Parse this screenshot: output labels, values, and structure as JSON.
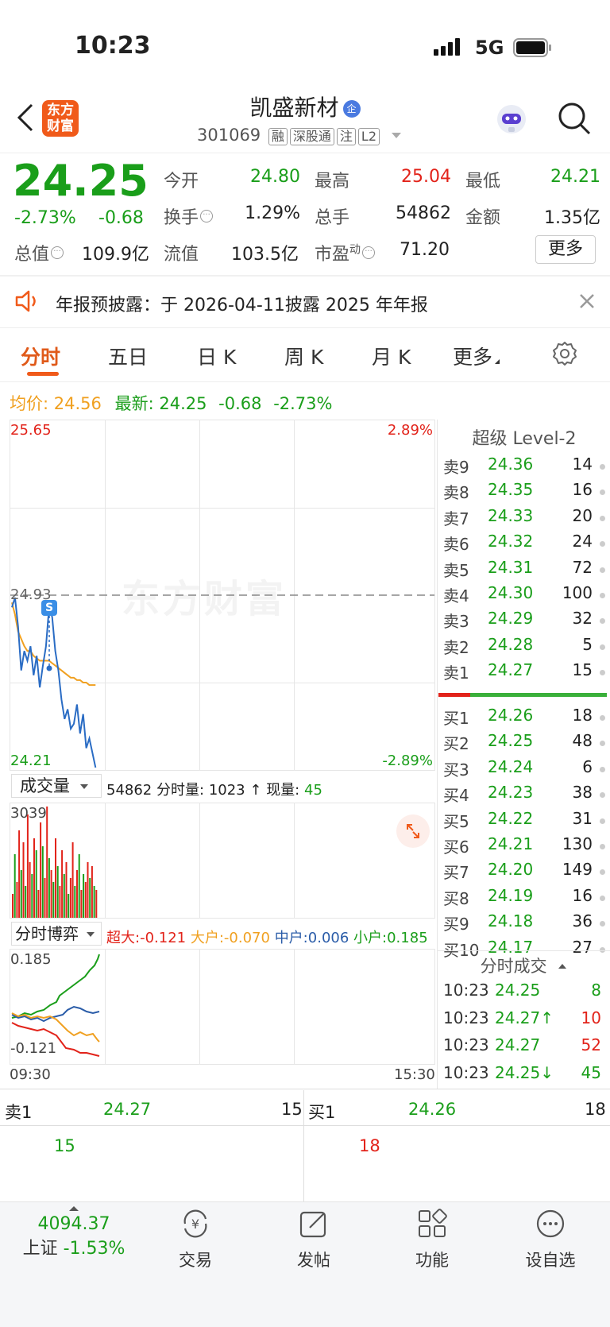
{
  "status_bar": {
    "time": "10:23",
    "network": "5G"
  },
  "header": {
    "name": "凯盛新材",
    "badge": "企",
    "code": "301069",
    "tags": [
      "融",
      "深股通",
      "注",
      "L2"
    ],
    "logo_line1": "东方",
    "logo_line2": "财富"
  },
  "quote": {
    "price": "24.25",
    "change_pct": "-2.73%",
    "change": "-0.68",
    "open_label": "今开",
    "open": "24.80",
    "high_label": "最高",
    "high": "25.04",
    "low_label": "最低",
    "low": "24.21",
    "turnover_label": "换手",
    "turnover": "1.29%",
    "volume_label": "总手",
    "volume": "54862",
    "amount_label": "金额",
    "amount": "1.35亿",
    "mktcap_label": "总值",
    "mktcap": "109.9亿",
    "float_label": "流值",
    "float": "103.5亿",
    "pe_label": "市盈",
    "pe_sup": "动",
    "pe": "71.20",
    "more": "更多"
  },
  "notice": {
    "text": "年报预披露：于 2026-04-11披露 2025 年年报"
  },
  "tabs": [
    "分时",
    "五日",
    "日 K",
    "周 K",
    "月 K",
    "更多"
  ],
  "summary": {
    "avg_label": "均价:",
    "avg": "24.56",
    "latest_label": "最新:",
    "latest": "24.25",
    "change": "-0.68",
    "pct": "-2.73%"
  },
  "chart": {
    "y_high": "25.65",
    "y_low": "24.21",
    "y_ref": "24.93",
    "pct_high": "2.89%",
    "pct_low": "-2.89%",
    "watermark": "东方财富",
    "marker": "S",
    "volume_selector": "成交量",
    "volume_info_total": "54862",
    "volume_info_label": "分时量:",
    "volume_info_val": "1023",
    "volume_info_now_label": "现量:",
    "volume_info_now": "45",
    "volume_max": "3039",
    "flow_selector": "分时博弈",
    "flow": [
      {
        "label": "超大:",
        "value": "-0.121",
        "color": "#e2231a"
      },
      {
        "label": "大户:",
        "value": "-0.070",
        "color": "#f0a020"
      },
      {
        "label": "中户:",
        "value": "0.006",
        "color": "#2a5ca8"
      },
      {
        "label": "小户:",
        "value": "0.185",
        "color": "#1a9e1a"
      }
    ],
    "flow_max": "0.185",
    "flow_min": "-0.121",
    "time_start": "09:30",
    "time_end": "15:30",
    "price_series": [
      24.88,
      24.92,
      24.8,
      24.62,
      24.7,
      24.66,
      24.72,
      24.6,
      24.68,
      24.55,
      24.64,
      24.72,
      24.88,
      24.84,
      24.7,
      24.62,
      24.5,
      24.42,
      24.46,
      24.38,
      24.4,
      24.48,
      24.36,
      24.44,
      24.3,
      24.34,
      24.28,
      24.22
    ],
    "avg_series": [
      24.9,
      24.85,
      24.78,
      24.75,
      24.72,
      24.7,
      24.7,
      24.68,
      24.67,
      24.66,
      24.66,
      24.66,
      24.66,
      24.65,
      24.64,
      24.63,
      24.62,
      24.61,
      24.6,
      24.59,
      24.59,
      24.58,
      24.58,
      24.57,
      24.57,
      24.56,
      24.56,
      24.56
    ]
  },
  "level2": {
    "title": "超级 Level-2",
    "asks": [
      {
        "label": "卖9",
        "price": "24.36",
        "vol": "14"
      },
      {
        "label": "卖8",
        "price": "24.35",
        "vol": "16"
      },
      {
        "label": "卖7",
        "price": "24.33",
        "vol": "20"
      },
      {
        "label": "卖6",
        "price": "24.32",
        "vol": "24"
      },
      {
        "label": "卖5",
        "price": "24.31",
        "vol": "72"
      },
      {
        "label": "卖4",
        "price": "24.30",
        "vol": "100"
      },
      {
        "label": "卖3",
        "price": "24.29",
        "vol": "32"
      },
      {
        "label": "卖2",
        "price": "24.28",
        "vol": "5"
      },
      {
        "label": "卖1",
        "price": "24.27",
        "vol": "15"
      }
    ],
    "bids": [
      {
        "label": "买1",
        "price": "24.26",
        "vol": "18"
      },
      {
        "label": "买2",
        "price": "24.25",
        "vol": "48"
      },
      {
        "label": "买3",
        "price": "24.24",
        "vol": "6"
      },
      {
        "label": "买4",
        "price": "24.23",
        "vol": "38"
      },
      {
        "label": "买5",
        "price": "24.22",
        "vol": "31"
      },
      {
        "label": "买6",
        "price": "24.21",
        "vol": "130"
      },
      {
        "label": "买7",
        "price": "24.20",
        "vol": "149"
      },
      {
        "label": "买8",
        "price": "24.19",
        "vol": "16"
      },
      {
        "label": "买9",
        "price": "24.18",
        "vol": "36"
      },
      {
        "label": "买10",
        "price": "24.17",
        "vol": "27"
      }
    ],
    "ticks_title": "分时成交",
    "ticks": [
      {
        "time": "10:23",
        "price": "24.25",
        "vol": "8",
        "color": "#1a9e1a",
        "vcolor": "#1a9e1a"
      },
      {
        "time": "10:23",
        "price": "24.27↑",
        "vol": "10",
        "color": "#1a9e1a",
        "vcolor": "#e2231a"
      },
      {
        "time": "10:23",
        "price": "24.27",
        "vol": "52",
        "color": "#1a9e1a",
        "vcolor": "#e2231a"
      },
      {
        "time": "10:23",
        "price": "24.25↓",
        "vol": "45",
        "color": "#1a9e1a",
        "vcolor": "#1a9e1a"
      }
    ]
  },
  "bottom_quote": {
    "ask_label": "卖1",
    "ask_price": "24.27",
    "ask_vol": "15",
    "ask_sub": "15",
    "bid_label": "买1",
    "bid_price": "24.26",
    "bid_vol": "18",
    "bid_sub": "18"
  },
  "bottom_nav": {
    "index_value": "4094.37",
    "index_name": "上证",
    "index_change": "-1.53%",
    "items": [
      {
        "label": "交易",
        "icon": "yen-cycle-icon"
      },
      {
        "label": "发帖",
        "icon": "edit-icon"
      },
      {
        "label": "功能",
        "icon": "grid-icon"
      },
      {
        "label": "设自选",
        "icon": "more-icon"
      }
    ]
  }
}
